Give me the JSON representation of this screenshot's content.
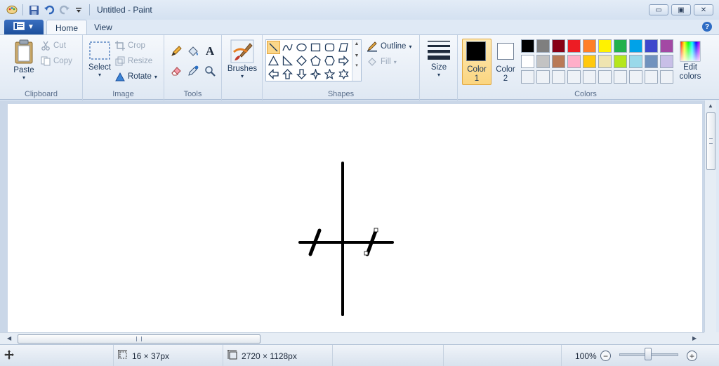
{
  "window": {
    "title": "Untitled - Paint",
    "controls": {
      "minimize": "▭",
      "restore": "▣",
      "close": "✕"
    }
  },
  "quick_access": {
    "icons": [
      "paint-app-icon",
      "save-icon",
      "undo-icon",
      "redo-icon",
      "customize-dropdown-icon"
    ]
  },
  "tabs": [
    {
      "label": "Home",
      "active": true
    },
    {
      "label": "View",
      "active": false
    }
  ],
  "ribbon": {
    "clipboard": {
      "label": "Clipboard",
      "paste": "Paste",
      "cut": "Cut",
      "copy": "Copy"
    },
    "image": {
      "label": "Image",
      "select": "Select",
      "crop": "Crop",
      "resize": "Resize",
      "rotate": "Rotate"
    },
    "tools": {
      "label": "Tools",
      "items": [
        "pencil-icon",
        "fill-icon",
        "text-icon",
        "eraser-icon",
        "color-picker-icon",
        "magnifier-icon"
      ]
    },
    "brushes": {
      "label": "Brushes"
    },
    "shapes": {
      "label": "Shapes",
      "outline": "Outline",
      "fill": "Fill",
      "selected_shape": "line"
    },
    "size": {
      "label": "Size"
    },
    "colors": {
      "label": "Colors",
      "color1_label": "Color",
      "color1_num": "1",
      "color2_label": "Color",
      "color2_num": "2",
      "edit_label_1": "Edit",
      "edit_label_2": "colors",
      "color1": "#000000",
      "color2": "#ffffff",
      "palette_row1": [
        "#000000",
        "#7f7f7f",
        "#880015",
        "#ed1c24",
        "#ff7f27",
        "#fff200",
        "#22b14c",
        "#00a2e8",
        "#3f48cc",
        "#a349a4"
      ],
      "palette_row2": [
        "#ffffff",
        "#c3c3c3",
        "#b97a57",
        "#ffaec9",
        "#ffc90e",
        "#efe4b0",
        "#b5e61d",
        "#99d9ea",
        "#7092be",
        "#c8bfe7"
      ],
      "palette_row3": [
        "",
        "",
        "",
        "",
        "",
        "",
        "",
        "",
        "",
        ""
      ]
    }
  },
  "status": {
    "selection_size": "16 × 37px",
    "canvas_size": "2720 × 1128px",
    "zoom": "100%",
    "zoom_fraction": 0.5
  }
}
